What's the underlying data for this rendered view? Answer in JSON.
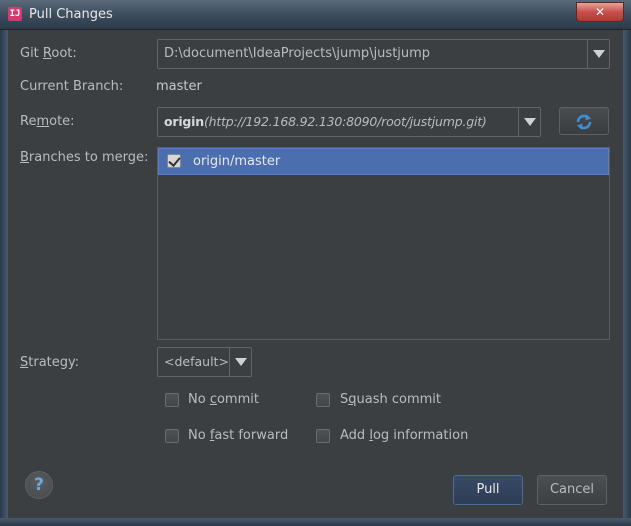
{
  "window": {
    "title": "Pull Changes",
    "app_icon": "IJ",
    "close_glyph": "✕"
  },
  "git_root": {
    "label_pre": "Git ",
    "label_mnemonic": "R",
    "label_post": "oot:",
    "value": "D:\\document\\IdeaProjects\\jump\\justjump"
  },
  "current_branch": {
    "label": "Current Branch:",
    "value": "master"
  },
  "remote": {
    "label_pre": "Re",
    "label_mnemonic": "m",
    "label_post": "ote:",
    "name": "origin",
    "url": "(http://192.168.92.130:8090/root/justjump.git)"
  },
  "branches": {
    "label_mnemonic": "B",
    "label_post": "ranches to merge:",
    "items": [
      {
        "name": "origin/master",
        "checked": true,
        "selected": true
      }
    ]
  },
  "strategy": {
    "label_mnemonic": "S",
    "label_post": "trategy:",
    "value": "<default>"
  },
  "options": {
    "no_commit": {
      "pre": "No ",
      "mnemonic": "c",
      "post": "ommit",
      "checked": false
    },
    "squash_commit": {
      "pre": "S",
      "mnemonic": "q",
      "post": "uash commit",
      "checked": false
    },
    "no_fast_forward": {
      "pre": "No ",
      "mnemonic": "f",
      "post": "ast forward",
      "checked": false
    },
    "add_log": {
      "pre": "Add ",
      "mnemonic": "l",
      "post": "og information",
      "checked": false
    }
  },
  "buttons": {
    "help": "?",
    "pull": "Pull",
    "cancel": "Cancel"
  },
  "colors": {
    "background": "#3c3f41",
    "selection": "#4b6eaf",
    "text": "#bbbbbb",
    "refresh_icon": "#3d8fd6"
  }
}
